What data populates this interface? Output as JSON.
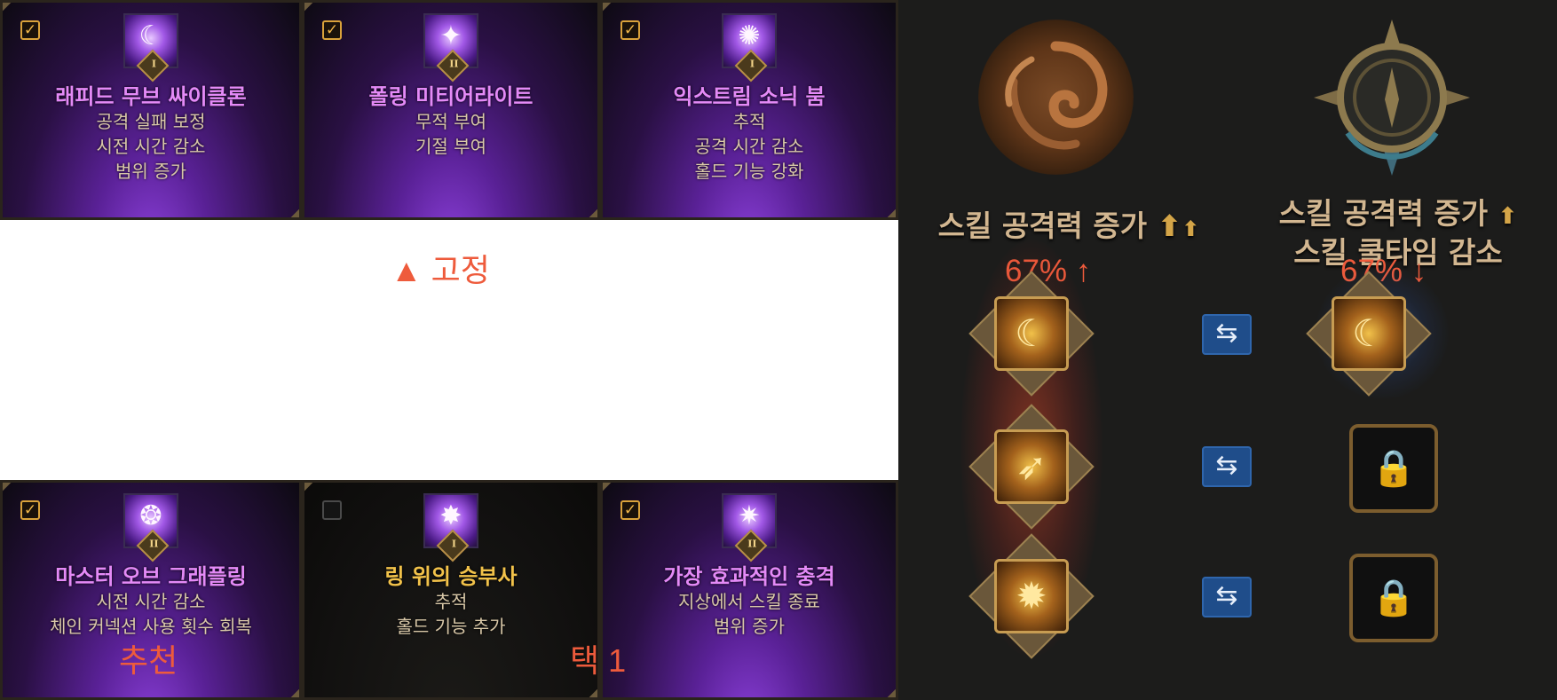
{
  "cards_top": [
    {
      "checked": true,
      "icon": "cyclone-skill-icon",
      "rank": "I",
      "title": "래피드 무브 싸이클론",
      "title_color": "purple",
      "lines": [
        "공격 실패 보정",
        "시전 시간 감소",
        "범위 증가"
      ]
    },
    {
      "checked": true,
      "icon": "meteor-skill-icon",
      "rank": "II",
      "title": "폴링 미티어라이트",
      "title_color": "purple",
      "lines": [
        "무적 부여",
        "기절 부여"
      ]
    },
    {
      "checked": true,
      "icon": "sonic-boom-skill-icon",
      "rank": "I",
      "title": "익스트림 소닉 붐",
      "title_color": "purple",
      "lines": [
        "추적",
        "공격 시간 감소",
        "홀드 기능 강화"
      ]
    }
  ],
  "cards_bottom": [
    {
      "checked": true,
      "icon": "grappling-skill-icon",
      "rank": "II",
      "title": "마스터 오브 그래플링",
      "title_color": "purple",
      "lines": [
        "시전 시간 감소",
        "체인 커넥션 사용 횟수 회복"
      ]
    },
    {
      "checked": false,
      "icon": "ring-fighter-skill-icon",
      "rank": "I",
      "title": "링 위의 승부사",
      "title_color": "gold",
      "lines": [
        "추적",
        "홀드 기능 추가"
      ]
    },
    {
      "checked": true,
      "icon": "impact-skill-icon",
      "rank": "II",
      "title": "가장 효과적인 충격",
      "title_color": "purple",
      "lines": [
        "지상에서 스킬 종료",
        "범위 증가"
      ]
    }
  ],
  "annotations": {
    "fixed": "▲ 고정",
    "recommend": "추천",
    "pick": "택 1"
  },
  "panel": {
    "left_emblem": "spiral-emblem-icon",
    "right_emblem": "compass-emblem-icon",
    "left_label": "스킬 공격력 증가",
    "right_label_1": "스킬 공격력 증가",
    "right_label_2": "스킬 쿨타임 감소",
    "left_pct": "67% ↑",
    "right_pct": "67% ↓",
    "swap_glyph": "⇆",
    "lock_glyph": "🔒",
    "slots": [
      {
        "left_icon": "cyclone-core-icon",
        "right_icon": "cyclone-core-icon",
        "right_locked": false
      },
      {
        "left_icon": "dash-core-icon",
        "right_locked": true
      },
      {
        "left_icon": "burst-core-icon",
        "right_locked": true
      }
    ]
  },
  "colors": {
    "annotation": "#ee5b3c",
    "purple_title": "#e48af7",
    "gold_title": "#f2c24a",
    "panel_bg": "#1c1c1b"
  }
}
